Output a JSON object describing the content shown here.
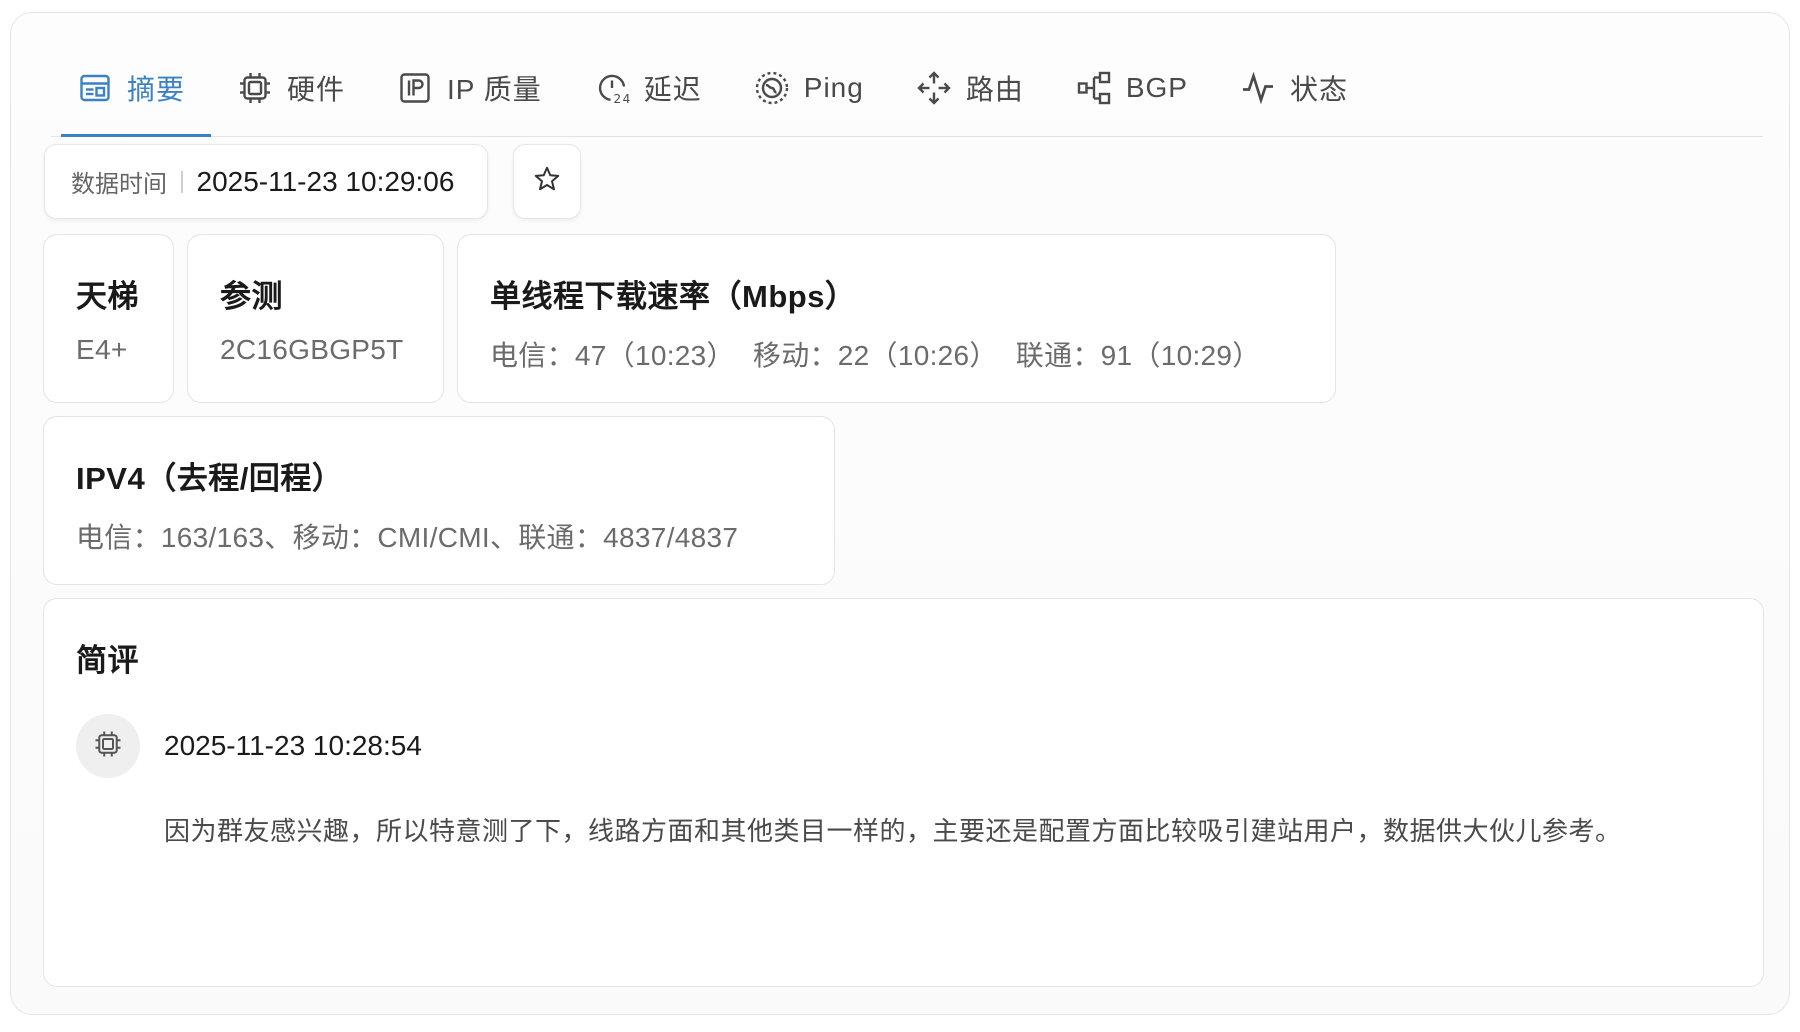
{
  "tabs": [
    {
      "label": "摘要",
      "icon": "summary-icon",
      "active": true
    },
    {
      "label": "硬件",
      "icon": "cpu-icon"
    },
    {
      "label": "IP 质量",
      "icon": "ip-icon"
    },
    {
      "label": "延迟",
      "icon": "latency-24-icon"
    },
    {
      "label": "Ping",
      "icon": "globe-icon"
    },
    {
      "label": "路由",
      "icon": "route-icon"
    },
    {
      "label": "BGP",
      "icon": "bgp-network-icon"
    },
    {
      "label": "状态",
      "icon": "activity-icon"
    }
  ],
  "data_time": {
    "label": "数据时间",
    "value": "2025-11-23 10:29:06"
  },
  "cards": {
    "tier": {
      "title": "天梯",
      "value": "E4+"
    },
    "spec": {
      "title": "参测",
      "value": "2C16GBGP5T"
    },
    "speed": {
      "title": "单线程下载速率（Mbps）",
      "value": "电信：47（10:23） 移动：22（10:26） 联通：91（10:29）"
    },
    "ipv4": {
      "title": "IPV4（去程/回程）",
      "value": "电信：163/163、移动：CMI/CMI、联通：4837/4837"
    }
  },
  "review": {
    "title": "简评",
    "time": "2025-11-23 10:28:54",
    "body": "因为群友感兴趣，所以特意测了下，线路方面和其他类目一样的，主要还是配置方面比较吸引建站用户，数据供大伙儿参考。"
  },
  "colors": {
    "accent": "#3b82c4",
    "text": "#1a1a1a",
    "muted": "#6b6b6b",
    "border": "#e4e4e4"
  }
}
